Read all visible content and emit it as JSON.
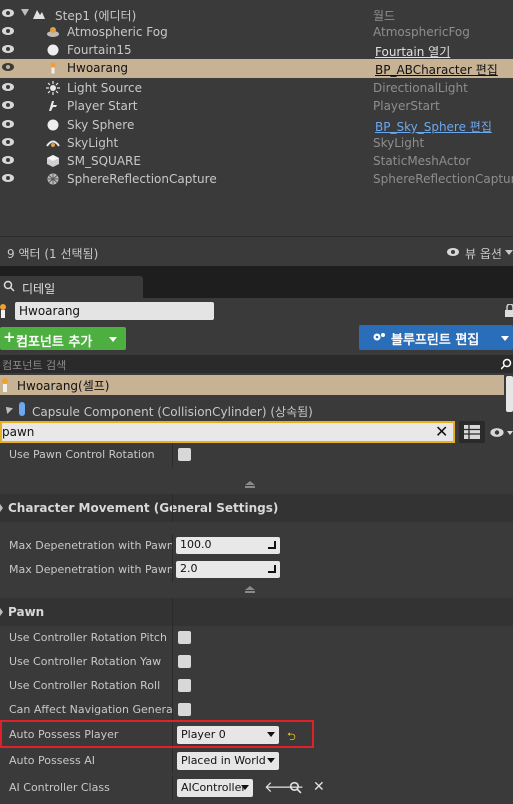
{
  "outliner": {
    "rows": [
      {
        "name": "Step1 (에디터)",
        "type": "월드",
        "icon": "world-icon"
      },
      {
        "name": "Atmospheric Fog",
        "type": "AtmosphericFog",
        "icon": "fog-icon"
      },
      {
        "name": "Fourtain15",
        "type": "Fourtain 열기",
        "icon": "sphere-icon",
        "type_link": true
      },
      {
        "name": "Hwoarang",
        "type": "BP_ABCharacter 편집",
        "icon": "pawn-icon",
        "type_link": true,
        "selected": true
      },
      {
        "name": "Light Source",
        "type": "DirectionalLight",
        "icon": "sun-icon"
      },
      {
        "name": "Player Start",
        "type": "PlayerStart",
        "icon": "player-start-icon"
      },
      {
        "name": "Sky Sphere",
        "type": "BP_Sky_Sphere 편집",
        "icon": "sphere-icon",
        "type_link": true
      },
      {
        "name": "SkyLight",
        "type": "SkyLight",
        "icon": "skylight-icon"
      },
      {
        "name": "SM_SQUARE",
        "type": "StaticMeshActor",
        "icon": "mesh-icon"
      },
      {
        "name": "SphereReflectionCapture",
        "type": "SphereReflectionCapture",
        "icon": "reflection-icon"
      }
    ],
    "actor_count": "9 액터 (1 선택됨)",
    "view_options": "뷰 옵션"
  },
  "details": {
    "tab_label": "디테일",
    "actor_name": "Hwoarang",
    "add_component": "컴포넌트 추가",
    "edit_blueprint": "블루프린트 편집",
    "component_search_placeholder": "컴포넌트 검색",
    "self_component": "Hwoarang(셀프)",
    "capsule_component": "Capsule Component (CollisionCylinder) (상속됨)",
    "filter_value": "pawn"
  },
  "props": {
    "use_pawn_control_rotation": "Use Pawn Control Rotation",
    "section_char_movement": "Character Movement (General Settings)",
    "max_depen_pawn": "Max Depenetration with Pawn",
    "max_depen_pawn_value": "100.0",
    "max_depen_pawn_as": "Max Depenetration with Pawn as",
    "max_depen_pawn_as_value": "2.0",
    "section_pawn": "Pawn",
    "use_ctrl_pitch": "Use Controller Rotation Pitch",
    "use_ctrl_yaw": "Use Controller Rotation Yaw",
    "use_ctrl_roll": "Use Controller Rotation Roll",
    "can_affect_nav": "Can Affect Navigation Generation",
    "auto_possess_player": "Auto Possess Player",
    "auto_possess_player_value": "Player 0",
    "auto_possess_ai": "Auto Possess AI",
    "auto_possess_ai_value": "Placed in World",
    "ai_controller_class": "AI Controller Class",
    "ai_controller_class_value": "AIController"
  },
  "colors": {
    "accent_green": "#4caf3f",
    "accent_blue": "#2a6db8",
    "selection_tan": "#c8b294",
    "highlight_red": "#e0202a",
    "filter_border": "#e8b020"
  }
}
